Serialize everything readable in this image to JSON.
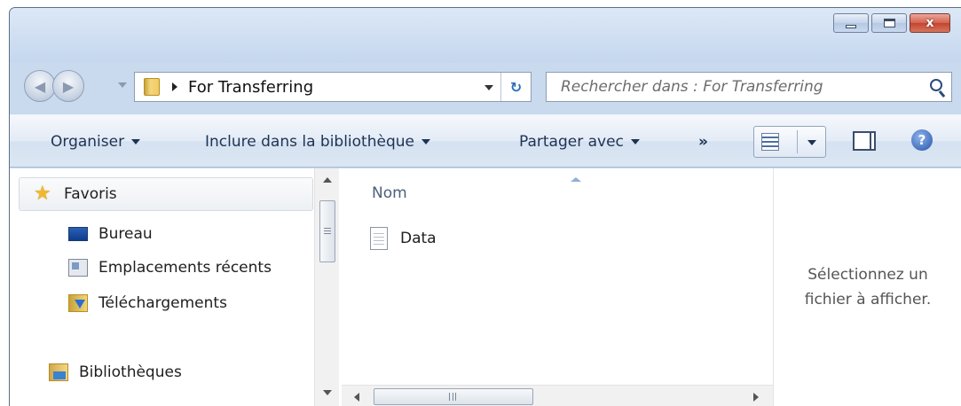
{
  "window": {
    "caption_buttons": [
      "minimize",
      "maximize",
      "close"
    ],
    "close_glyph": "x"
  },
  "address": {
    "path_label": "For Transferring",
    "refresh_glyph": "↻"
  },
  "search": {
    "placeholder": "Rechercher dans : For Transferring"
  },
  "commandbar": {
    "organize": "Organiser",
    "include_in_library": "Inclure dans la bibliothèque",
    "share_with": "Partager avec",
    "more": "»",
    "help_glyph": "?"
  },
  "navpane": {
    "items": [
      {
        "label": "Favoris",
        "icon": "star-icon"
      },
      {
        "label": "Bureau",
        "icon": "desktop-icon"
      },
      {
        "label": "Emplacements récents",
        "icon": "recent-places-icon"
      },
      {
        "label": "Téléchargements",
        "icon": "downloads-icon"
      },
      {
        "label": "Bibliothèques",
        "icon": "libraries-icon"
      }
    ]
  },
  "filelist": {
    "column_name": "Nom",
    "files": [
      {
        "name": "Data",
        "icon": "text-file-icon"
      }
    ]
  },
  "preview": {
    "line1": "Sélectionnez un",
    "line2": "fichier à afficher."
  },
  "colors": {
    "accent": "#2353a8",
    "frame": "#c9daef"
  }
}
